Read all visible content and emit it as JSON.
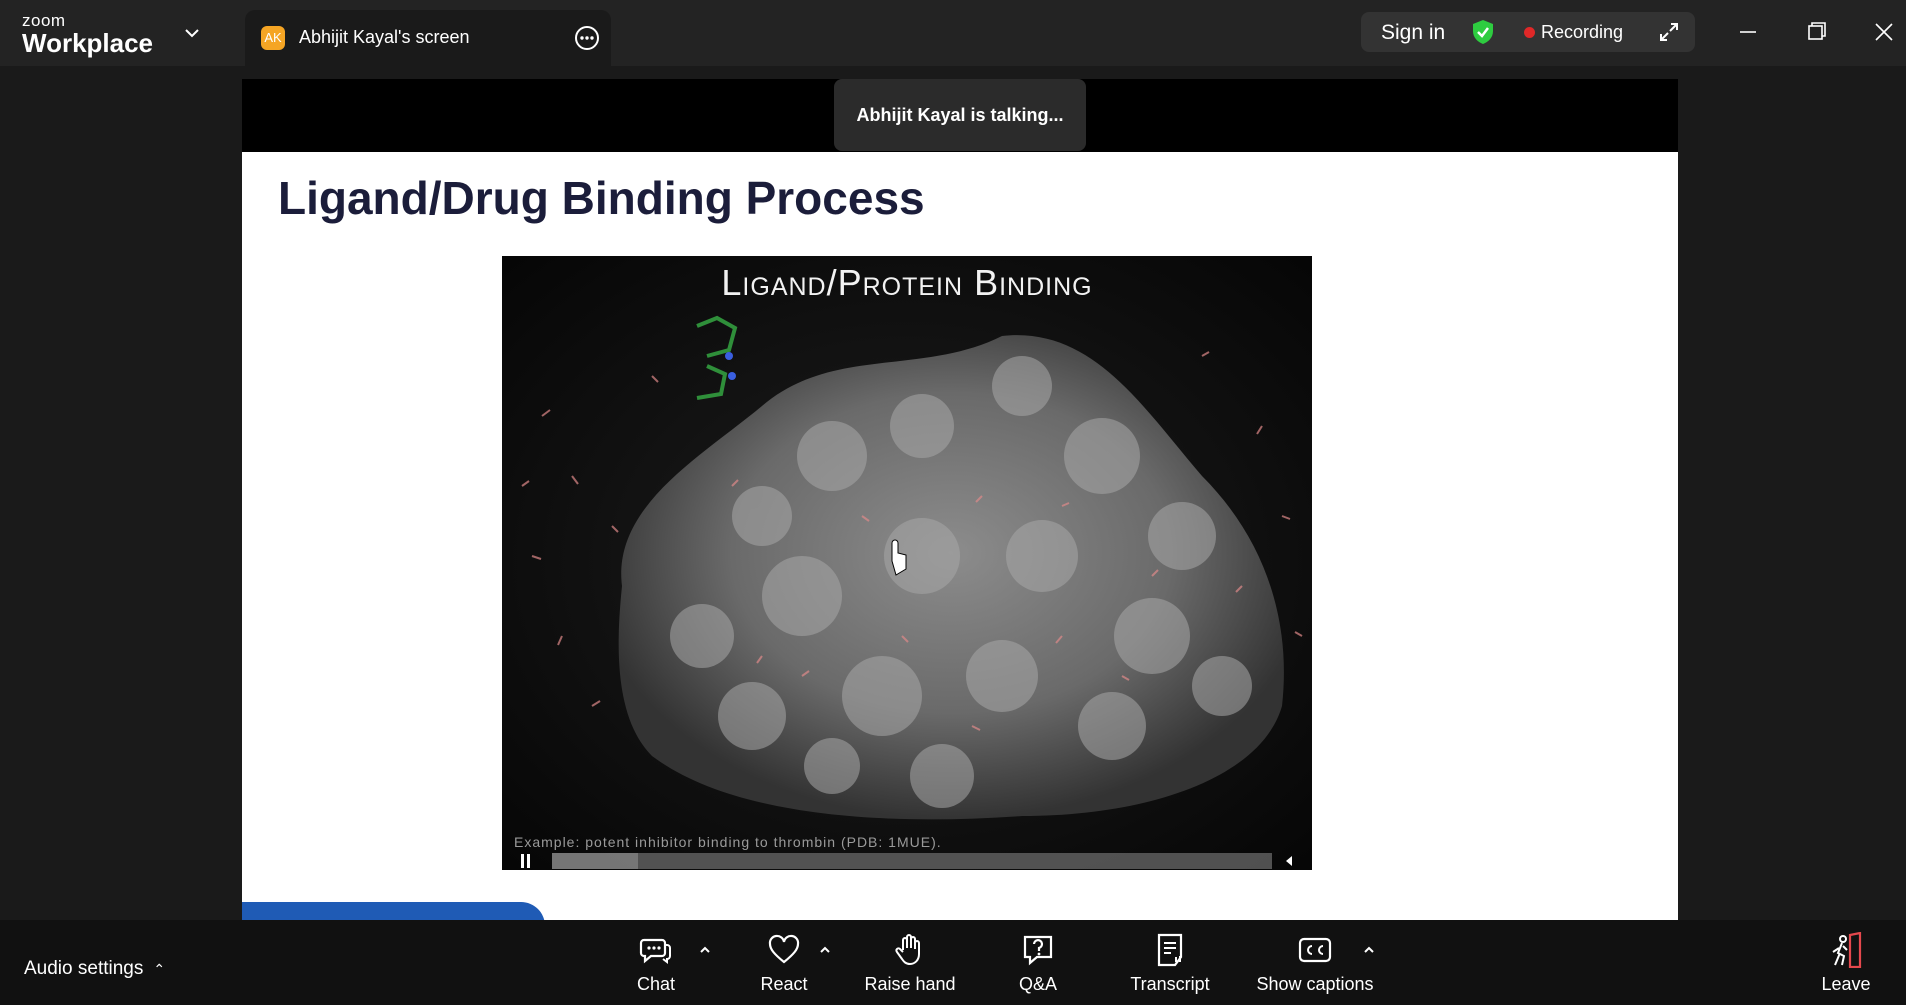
{
  "app": {
    "brand_top": "zoom",
    "brand_bottom": "Workplace"
  },
  "share_tab": {
    "avatar_initials": "AK",
    "title": "Abhijit Kayal's screen"
  },
  "status": {
    "sign_in": "Sign in",
    "recording": "Recording"
  },
  "speaker_notice": "Abhijit Kayal is talking...",
  "slide": {
    "title": "Ligand/Drug Binding Process",
    "video_title": "Ligand/Protein Binding",
    "video_caption": "Example: potent inhibitor binding to thrombin (PDB: 1MUE).",
    "progress": 0.12
  },
  "toolbar": {
    "audio_settings": "Audio settings",
    "chat": "Chat",
    "react": "React",
    "raise_hand": "Raise hand",
    "qa": "Q&A",
    "transcript": "Transcript",
    "captions": "Show captions",
    "leave": "Leave"
  },
  "colors": {
    "record_dot": "#e02828",
    "shield": "#2ecc40",
    "leave": "#e5484d",
    "avatar": "#f5a524"
  }
}
